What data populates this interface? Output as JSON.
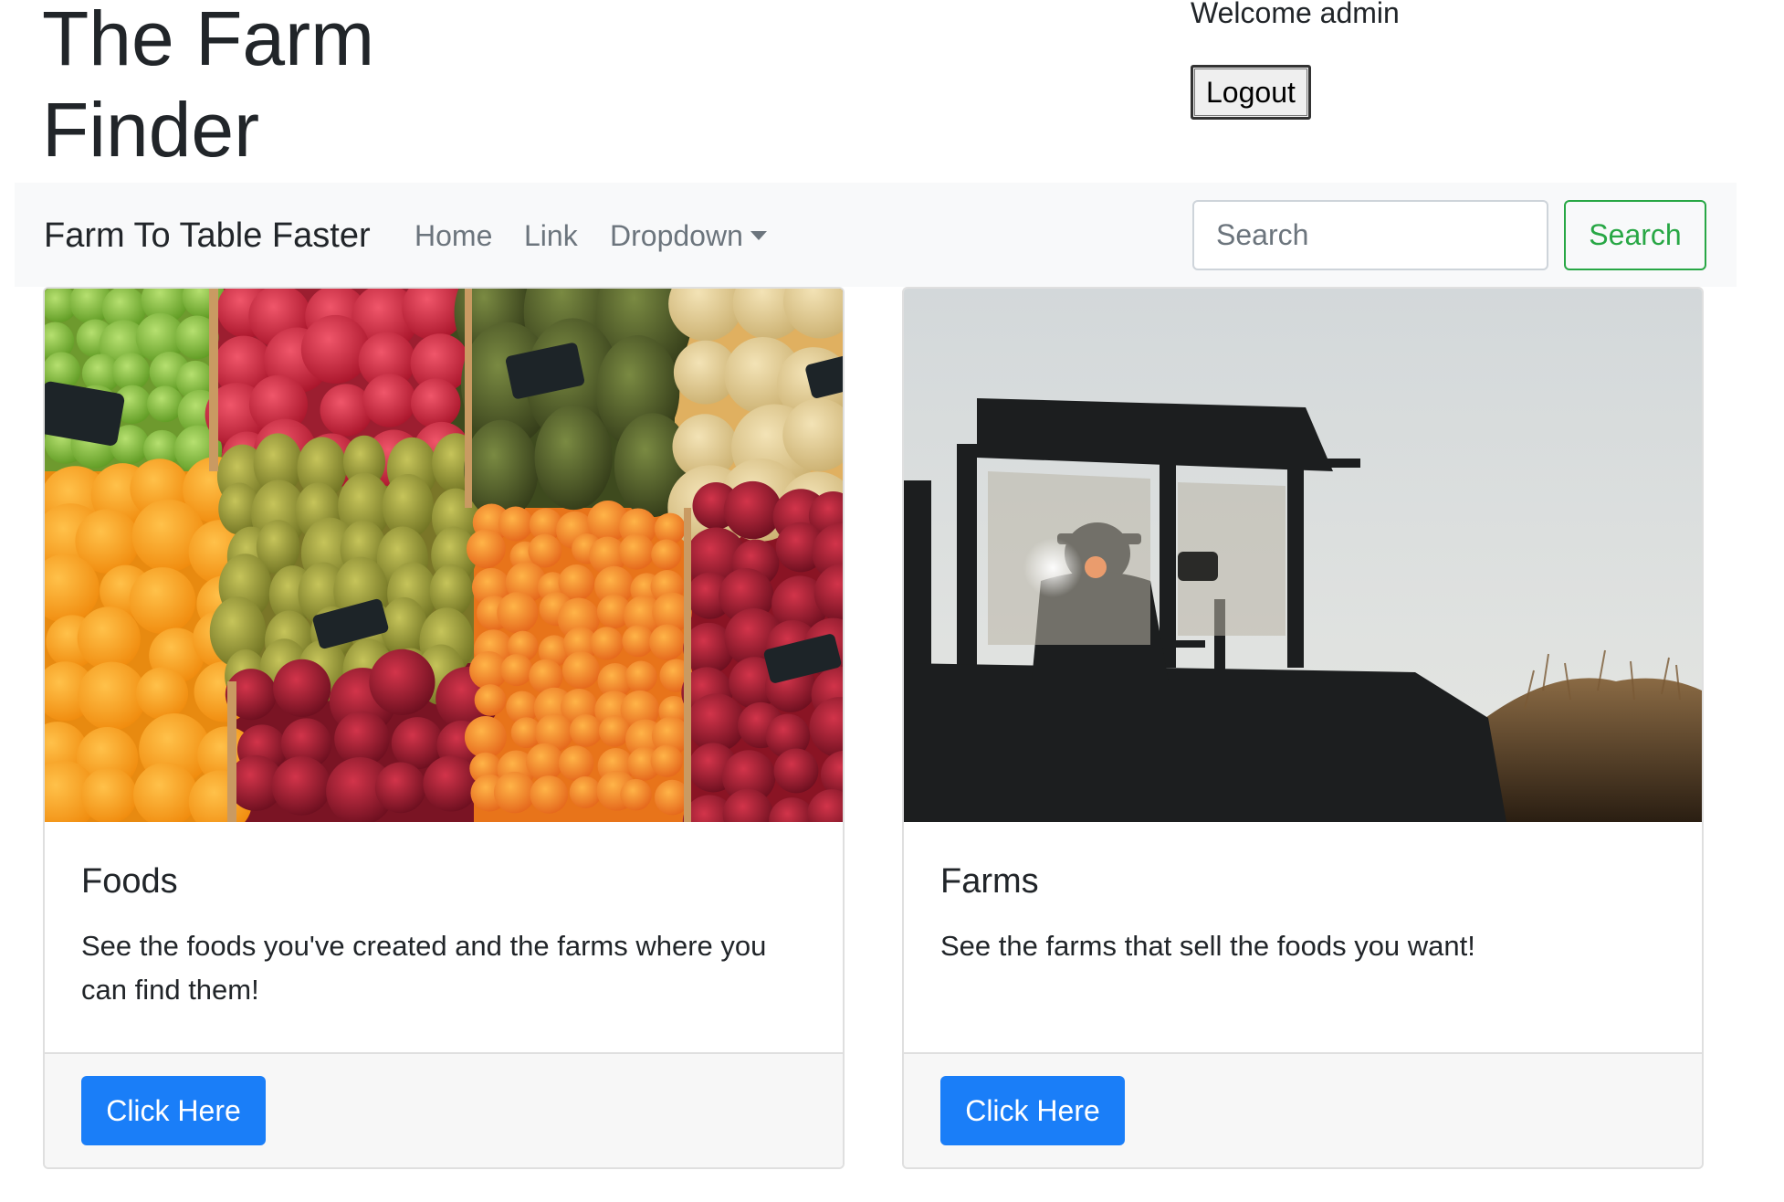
{
  "header": {
    "title": "The Farm Finder",
    "welcome_text": "Welcome admin",
    "logout_label": "Logout"
  },
  "navbar": {
    "brand": "Farm To Table Faster",
    "links": [
      "Home",
      "Link",
      "Dropdown"
    ],
    "search_placeholder": "Search",
    "search_button": "Search"
  },
  "cards": [
    {
      "image": "fruit-market-photo",
      "title": "Foods",
      "text": "See the foods you've created and the farms where you can find them!",
      "button": "Click Here"
    },
    {
      "image": "tractor-silhouette-photo",
      "title": "Farms",
      "text": "See the farms that sell the foods you want!",
      "button": "Click Here"
    }
  ],
  "colors": {
    "primary": "#1a7ef8",
    "success": "#28a745",
    "navbar_bg": "#f8f9fa",
    "muted": "#6c757d"
  }
}
